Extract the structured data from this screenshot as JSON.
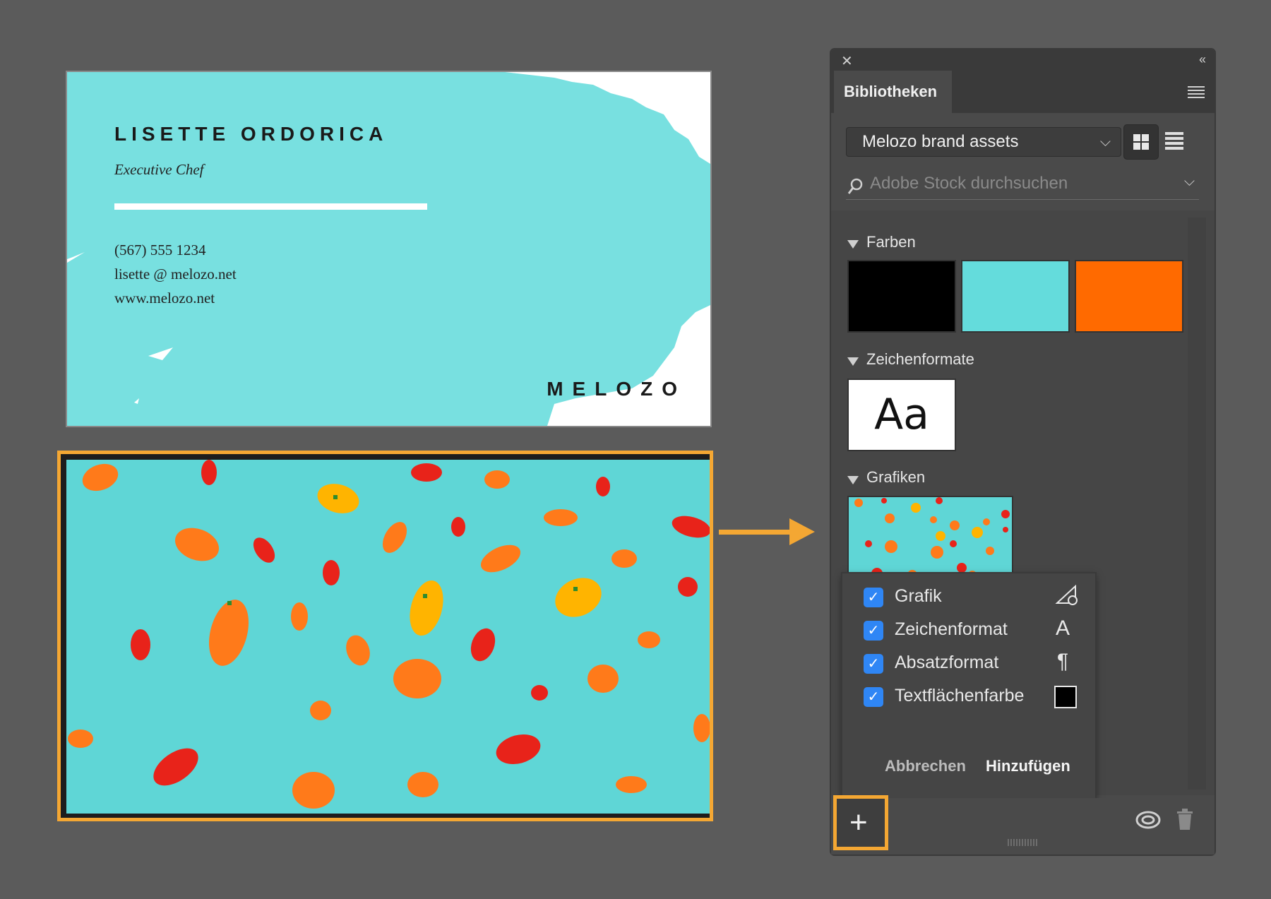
{
  "card": {
    "name": "LISETTE ORDORICA",
    "role": "Executive Chef",
    "phone": "(567) 555 1234",
    "email": "lisette @ melozo.net",
    "web": "www.melozo.net",
    "brand": "MELOZO",
    "background_color": "#78e0e0"
  },
  "panel": {
    "tab": "Bibliotheken",
    "library_select": "Melozo brand assets",
    "search_placeholder": "Adobe Stock durchsuchen",
    "sections": {
      "colors": {
        "title": "Farben",
        "swatches": [
          "#000000",
          "#64dcdc",
          "#ff6a00"
        ]
      },
      "char_styles": {
        "title": "Zeichenformate",
        "sample": "Aa"
      },
      "graphics": {
        "title": "Grafiken"
      }
    },
    "popup": {
      "options": [
        {
          "label": "Grafik",
          "checked": true,
          "icon": "graphic-icon"
        },
        {
          "label": "Zeichenformat",
          "checked": true,
          "icon": "character-style-icon",
          "glyph": "A"
        },
        {
          "label": "Absatzformat",
          "checked": true,
          "icon": "paragraph-style-icon",
          "glyph": "¶"
        },
        {
          "label": "Textflächenfarbe",
          "checked": true,
          "icon": "text-fill-color-icon"
        }
      ],
      "cancel": "Abbrechen",
      "add": "Hinzufügen"
    }
  },
  "accent_color": "#f4a733",
  "checkbox_color": "#2f86f5"
}
